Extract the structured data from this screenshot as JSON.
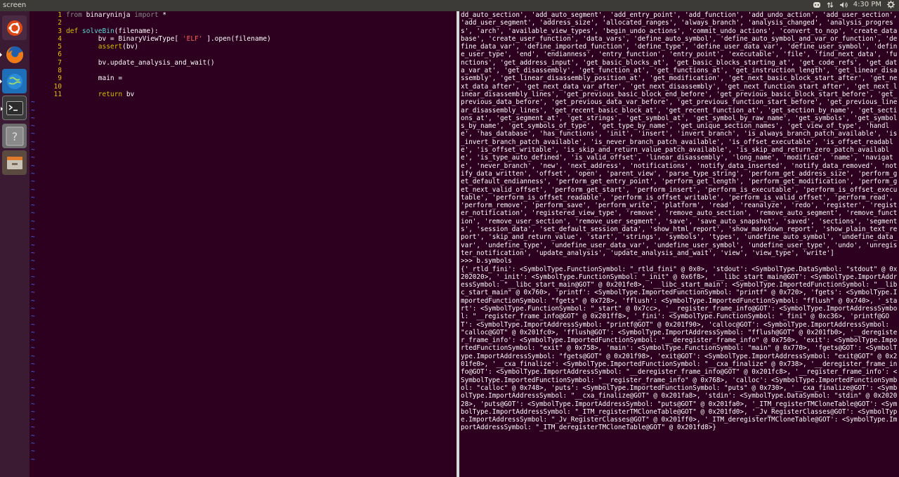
{
  "topbar": {
    "title": "screen",
    "clock": "4:30 PM",
    "icons": [
      "discord-icon",
      "network-icon",
      "volume-icon",
      "settings-gear-icon"
    ]
  },
  "launcher": {
    "items": [
      "ubuntu-dash-icon",
      "firefox-icon",
      "browser-globe-icon",
      "terminal-icon",
      "help-icon",
      "files-icon"
    ]
  },
  "editor": {
    "lines": [
      {
        "num": "1",
        "segments": [
          {
            "t": "from",
            "c": "cm"
          },
          {
            "t": " binaryninja ",
            "c": ""
          },
          {
            "t": "import",
            "c": "cm"
          },
          {
            "t": " *",
            "c": ""
          }
        ]
      },
      {
        "num": "2",
        "segments": []
      },
      {
        "num": "3",
        "segments": [
          {
            "t": "def",
            "c": "kw"
          },
          {
            "t": " ",
            "c": ""
          },
          {
            "t": "solveBin",
            "c": "fn"
          },
          {
            "t": "(filename):",
            "c": ""
          }
        ]
      },
      {
        "num": "4",
        "segments": [
          {
            "t": "        bv = BinaryViewType[ ",
            "c": ""
          },
          {
            "t": "'ELF'",
            "c": "str"
          },
          {
            "t": " ].open(filename)",
            "c": ""
          }
        ]
      },
      {
        "num": "5",
        "segments": [
          {
            "t": "        ",
            "c": ""
          },
          {
            "t": "assert",
            "c": "kw"
          },
          {
            "t": "(bv)",
            "c": ""
          }
        ]
      },
      {
        "num": "6",
        "segments": []
      },
      {
        "num": "7",
        "segments": [
          {
            "t": "        bv.update_analysis_and_wait()",
            "c": ""
          }
        ]
      },
      {
        "num": "8",
        "segments": []
      },
      {
        "num": "9",
        "segments": [
          {
            "t": "        main = ",
            "c": ""
          }
        ]
      },
      {
        "num": "10",
        "segments": []
      },
      {
        "num": "11",
        "segments": [
          {
            "t": "        ",
            "c": ""
          },
          {
            "t": "return",
            "c": "kw"
          },
          {
            "t": " bv",
            "c": ""
          }
        ]
      }
    ],
    "tilde": "~",
    "tilde_count": 46
  },
  "terminal": {
    "text": "dd_auto_section', 'add_auto_segment', 'add_entry_point', 'add_function', 'add_undo_action', 'add_user_section', 'add_user_segment', 'address_size', 'allocated_ranges', 'always_branch', 'analysis_changed', 'analysis_progress', 'arch', 'available_view_types', 'begin_undo_actions', 'commit_undo_actions', 'convert_to_nop', 'create_database', 'create_user_function', 'data_vars', 'define_auto_symbol', 'define_auto_symbol_and_var_or_function', 'define_data_var', 'define_imported_function', 'define_type', 'define_user_data_var', 'define_user_symbol', 'define_user_type', 'end', 'endianness', 'entry_function', 'entry_point', 'executable', 'file', 'find_next_data', 'functions', 'get_address_input', 'get_basic_blocks_at', 'get_basic_blocks_starting_at', 'get_code_refs', 'get_data_var_at', 'get_disassembly', 'get_function_at', 'get_functions_at', 'get_instruction_length', 'get_linear_disassembly', 'get_linear_disassembly_position_at', 'get_modification', 'get_next_basic_block_start_after', 'get_next_data_after', 'get_next_data_var_after', 'get_next_disassembly', 'get_next_function_start_after', 'get_next_linear_disassembly_lines', 'get_previous_basic_block_end_before', 'get_previous_basic_block_start_before', 'get_previous_data_before', 'get_previous_data_var_before', 'get_previous_function_start_before', 'get_previous_linear_disassembly_lines', 'get_recent_basic_block_at', 'get_recent_function_at', 'get_section_by_name', 'get_sections_at', 'get_segment_at', 'get_strings', 'get_symbol_at', 'get_symbol_by_raw_name', 'get_symbols', 'get_symbols_by_name', 'get_symbols_of_type', 'get_type_by_name', 'get_unique_section_names', 'get_view_of_type', 'handle', 'has_database', 'has_functions', 'init', 'insert', 'invert_branch', 'is_always_branch_patch_available', 'is_invert_branch_patch_available', 'is_never_branch_patch_available', 'is_offset_executable', 'is_offset_readable', 'is_offset_writable', 'is_skip_and_return_value_patch_available', 'is_skip_and_return_zero_patch_available', 'is_type_auto_defined', 'is_valid_offset', 'linear_disassembly', 'long_name', 'modified', 'name', 'navigate', 'never_branch', 'new', 'next_address', 'notifications', 'notify_data_inserted', 'notify_data_removed', 'notify_data_written', 'offset', 'open', 'parent_view', 'parse_type_string', 'perform_get_address_size', 'perform_get_default_endianness', 'perform_get_entry_point', 'perform_get_length', 'perform_get_modification', 'perform_get_next_valid_offset', 'perform_get_start', 'perform_insert', 'perform_is_executable', 'perform_is_offset_executable', 'perform_is_offset_readable', 'perform_is_offset_writable', 'perform_is_valid_offset', 'perform_read', 'perform_remove', 'perform_save', 'perform_write', 'platform', 'read', 'reanalyze', 'redo', 'register', 'register_notification', 'registered_view_type', 'remove', 'remove_auto_section', 'remove_auto_segment', 'remove_function', 'remove_user_section', 'remove_user_segment', 'save', 'save_auto_snapshot', 'saved', 'sections', 'segments', 'session_data', 'set_default_session_data', 'show_html_report', 'show_markdown_report', 'show_plain_text_report', 'skip_and_return_value', 'start', 'strings', 'symbols', 'types', 'undefine_auto_symbol', 'undefine_data_var', 'undefine_type', 'undefine_user_data_var', 'undefine_user_symbol', 'undefine_user_type', 'undo', 'unregister_notification', 'update_analysis', 'update_analysis_and_wait', 'view', 'view_type', 'write']\n>>> b.symbols\n{'_rtld_fini': <SymbolType.FunctionSymbol: \"_rtld_fini\" @ 0x0>, 'stdout': <SymbolType.DataSymbol: \"stdout\" @ 0x202020>, '_init': <SymbolType.FunctionSymbol: \"_init\" @ 0x6f8>, '__libc_start_main@GOT': <SymbolType.ImportAddressSymbol: \"__libc_start_main@GOT\" @ 0x201fe8>, '__libc_start_main': <SymbolType.ImportedFunctionSymbol: \"__libc_start_main\" @ 0x760>, 'printf': <SymbolType.ImportedFunctionSymbol: \"printf\" @ 0x720>, 'fgets': <SymbolType.ImportedFunctionSymbol: \"fgets\" @ 0x728>, 'fflush': <SymbolType.ImportedFunctionSymbol: \"fflush\" @ 0x740>, '_start': <SymbolType.FunctionSymbol: \"_start\" @ 0x7cc>, '__register_frame_info@GOT': <SymbolType.ImportAddressSymbol: \"__register_frame_info@GOT\" @ 0x201ff8>, '_fini': <SymbolType.FunctionSymbol: \"_fini\" @ 0xc36>, 'printf@GOT': <SymbolType.ImportAddressSymbol: \"printf@GOT\" @ 0x201f90>, 'calloc@GOT': <SymbolType.ImportAddressSymbol: \"calloc@GOT\" @ 0x201fc0>, 'fflush@GOT': <SymbolType.ImportAddressSymbol: \"fflush@GOT\" @ 0x201fb0>, '__deregister_frame_info': <SymbolType.ImportedFunctionSymbol: \"__deregister_frame_info\" @ 0x750>, 'exit': <SymbolType.ImportedFunctionSymbol: \"exit\" @ 0x758>, 'main': <SymbolType.FunctionSymbol: \"main\" @ 0x770>, 'fgets@GOT': <SymbolType.ImportAddressSymbol: \"fgets@GOT\" @ 0x201f98>, 'exit@GOT': <SymbolType.ImportAddressSymbol: \"exit@GOT\" @ 0x201fe0>, '__cxa_finalize': <SymbolType.ImportedFunctionSymbol: \"__cxa_finalize\" @ 0x738>, '__deregister_frame_info@GOT': <SymbolType.ImportAddressSymbol: \"__deregister_frame_info@GOT\" @ 0x201fc8>, '__register_frame_info': <SymbolType.ImportedFunctionSymbol: \"__register_frame_info\" @ 0x768>, 'calloc': <SymbolType.ImportedFunctionSymbol: \"calloc\" @ 0x748>, 'puts': <SymbolType.ImportedFunctionSymbol: \"puts\" @ 0x730>, '__cxa_finalize@GOT': <SymbolType.ImportAddressSymbol: \"__cxa_finalize@GOT\" @ 0x201fa8>, 'stdin': <SymbolType.DataSymbol: \"stdin\" @ 0x202028>, 'puts@GOT': <SymbolType.ImportAddressSymbol: \"puts@GOT\" @ 0x201fa0>, '_ITM_registerTMCloneTable@GOT': <SymbolType.ImportAddressSymbol: \"_ITM_registerTMCloneTable@GOT\" @ 0x201fd0>, '_Jv_RegisterClasses@GOT': <SymbolType.ImportAddressSymbol: \"_Jv_RegisterClasses@GOT\" @ 0x201ff0>, '_ITM_deregisterTMCloneTable@GOT': <SymbolType.ImportAddressSymbol: \"_ITM_deregisterTMCloneTable@GOT\" @ 0x201fd8>}"
  }
}
